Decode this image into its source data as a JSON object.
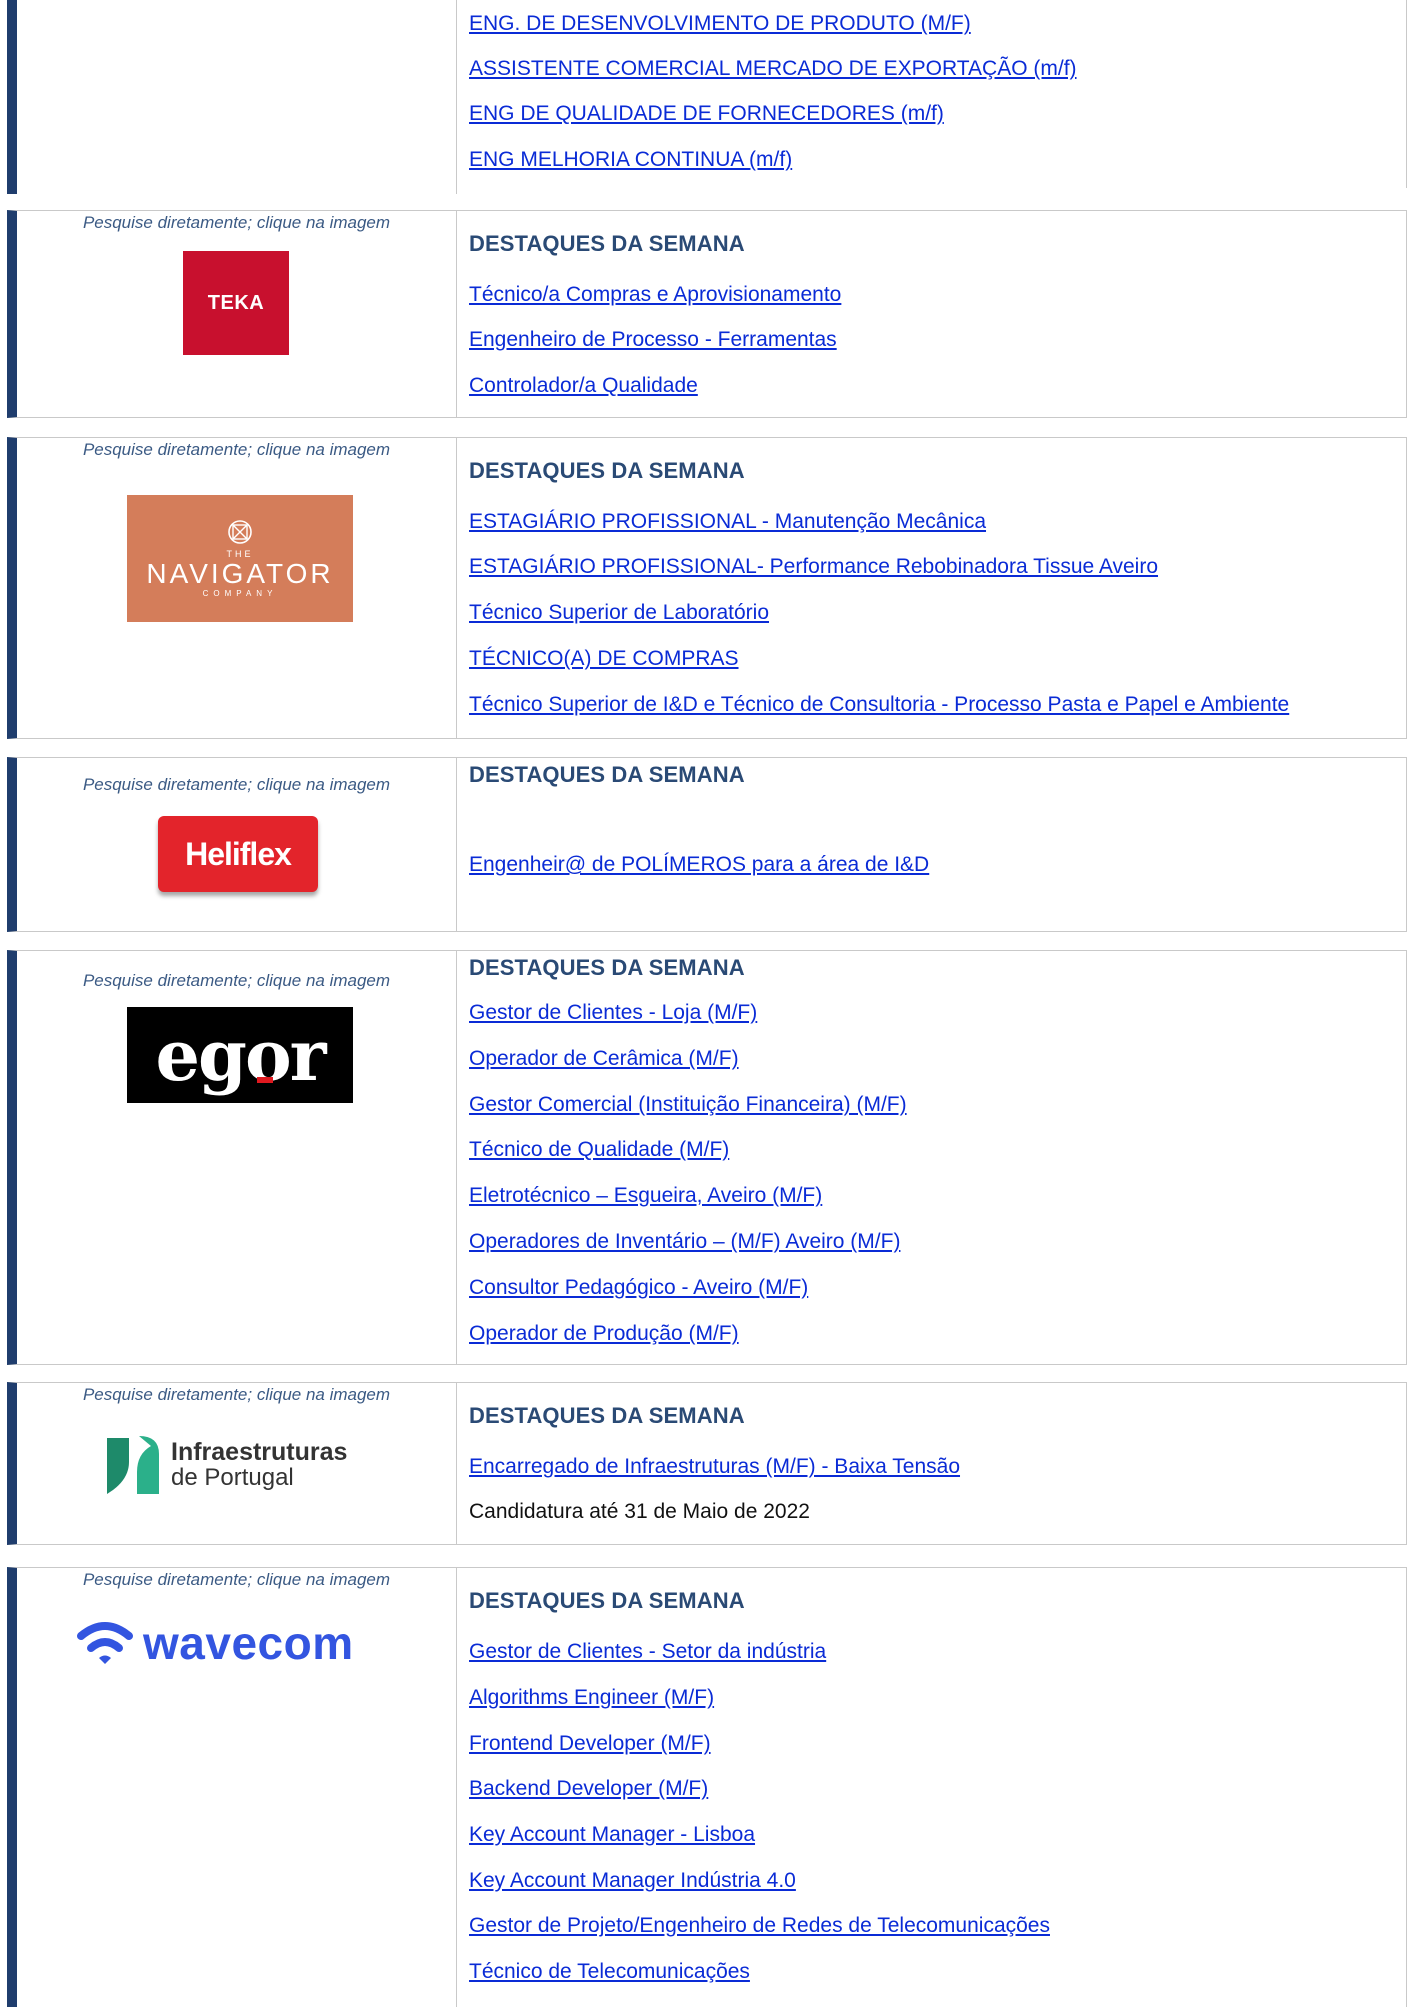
{
  "hint_text": "Pesquise diretamente; clique na imagem",
  "heading_text": "DESTAQUES DA SEMANA",
  "colors": {
    "accent_bar": "#1f3d6d",
    "link": "#0a2bd6",
    "heading": "#2a4a75"
  },
  "block0": {
    "jobs": [
      "ENG. DE DESENVOLVIMENTO DE PRODUTO (M/F)",
      "ASSISTENTE COMERCIAL MERCADO DE EXPORTAÇÃO (m/f)",
      "ENG DE QUALIDADE DE FORNECEDORES (m/f)",
      "ENG MELHORIA CONTINUA (m/f)"
    ]
  },
  "teka": {
    "logo_text": "TEKA",
    "jobs": [
      "Técnico/a Compras e Aprovisionamento",
      "Engenheiro de Processo - Ferramentas",
      "Controlador/a Qualidade"
    ]
  },
  "navigator": {
    "logo": {
      "the": "THE",
      "name": "NAVIGATOR",
      "company": "COMPANY"
    },
    "jobs": [
      "ESTAGIÁRIO PROFISSIONAL - Manutenção Mecânica",
      "ESTAGIÁRIO PROFISSIONAL- Performance Rebobinadora Tissue Aveiro",
      "Técnico Superior de Laboratório",
      "TÉCNICO(A) DE COMPRAS",
      "Técnico Superior de I&D e Técnico de Consultoria - Processo Pasta e Papel e Ambiente"
    ]
  },
  "heliflex": {
    "logo_text": "Heliflex",
    "jobs": [
      "Engenheir@ de POLÍMEROS para a área de I&D"
    ]
  },
  "egor": {
    "logo_text": "egor",
    "jobs": [
      "Gestor de Clientes - Loja (M/F)",
      "Operador de Cerâmica (M/F)",
      "Gestor Comercial (Instituição Financeira) (M/F)",
      "Técnico de Qualidade (M/F)",
      "Eletrotécnico – Esgueira, Aveiro (M/F)",
      "Operadores de Inventário – (M/F) Aveiro (M/F)",
      "Consultor Pedagógico - Aveiro (M/F)",
      "Operador de Produção (M/F)"
    ]
  },
  "ip": {
    "logo": {
      "line1": "Infraestruturas",
      "line2": "de Portugal"
    },
    "jobs": [
      "Encarregado de Infraestruturas (M/F) - Baixa Tensão"
    ],
    "note": "Candidatura até 31 de Maio de 2022"
  },
  "wavecom": {
    "logo_text": "wavecom",
    "jobs": [
      "Gestor de Clientes - Setor da indústria",
      "Algorithms Engineer (M/F)",
      "Frontend Developer (M/F)",
      "Backend Developer (M/F)",
      "Key Account Manager - Lisboa",
      "Key Account Manager Indústria 4.0",
      "Gestor de Projeto/Engenheiro de Redes de Telecomunicações",
      "Técnico de Telecomunicações"
    ]
  }
}
